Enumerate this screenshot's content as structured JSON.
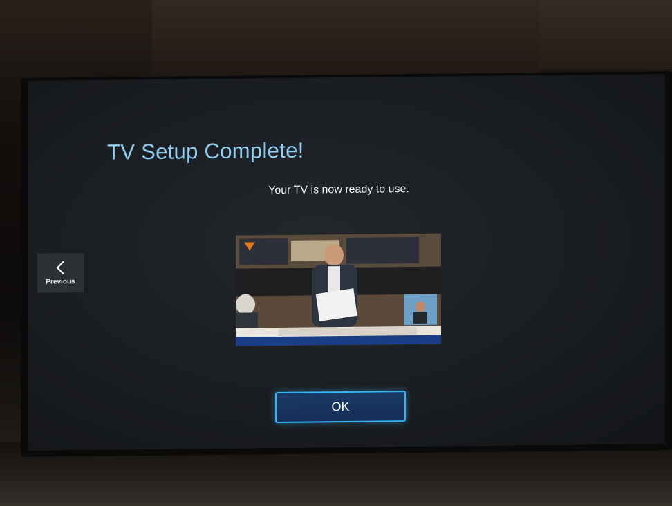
{
  "setup": {
    "title": "TV Setup Complete!",
    "message": "Your TV is now ready to use."
  },
  "navigation": {
    "previous_label": "Previous",
    "previous_icon": "chevron-left-icon"
  },
  "actions": {
    "ok_label": "OK"
  },
  "colors": {
    "title": "#8fd0f5",
    "ok_border": "#35b6f4",
    "ok_fill": "#1b3a66",
    "screen_bg": "#1a1d21"
  }
}
